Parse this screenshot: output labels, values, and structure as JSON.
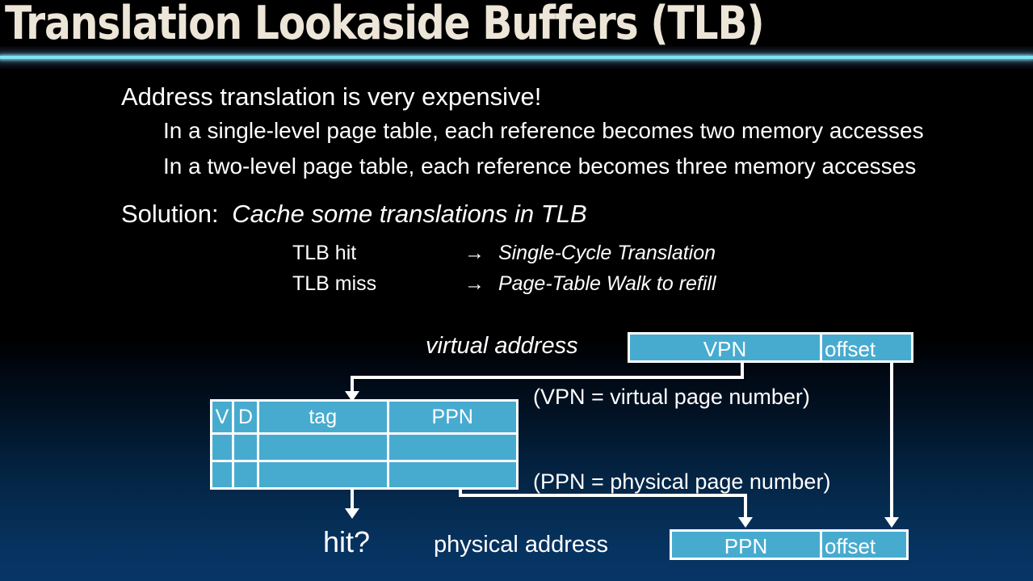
{
  "slide": {
    "title": "Translation Lookaside Buffers (TLB)",
    "accent_color": "#7fe3f0",
    "box_color": "#47abd0",
    "title_color": "#ece5d8",
    "text_color": "#ffffff",
    "background_top": "#000000",
    "background_bottom": "#073566"
  },
  "body": {
    "heading": "Address translation is very expensive!",
    "bullets": [
      "In a single-level page table, each reference becomes two memory accesses",
      "In a two-level page table, each reference becomes three memory accesses"
    ],
    "solution_prefix": "Solution:",
    "solution_emphasis": "Cache some translations in TLB",
    "outcomes": [
      {
        "case": "TLB hit",
        "arrow": "→",
        "result": "Single-Cycle Translation"
      },
      {
        "case": "TLB miss",
        "arrow": "→",
        "result": "Page-Table Walk to refill"
      }
    ]
  },
  "diagram": {
    "virtual_address_label": "virtual address",
    "physical_address_label": "physical address",
    "hit_label": "hit?",
    "virtual_address_fields": [
      "VPN",
      "offset"
    ],
    "physical_address_fields": [
      "PPN",
      "offset"
    ],
    "tlb_headers": [
      "V",
      "D",
      "tag",
      "PPN"
    ],
    "tlb_rows": [
      [
        "",
        "",
        "",
        ""
      ],
      [
        "",
        "",
        "",
        ""
      ]
    ],
    "annotations": [
      "(VPN = virtual page number)",
      "(PPN = physical page number)"
    ]
  }
}
